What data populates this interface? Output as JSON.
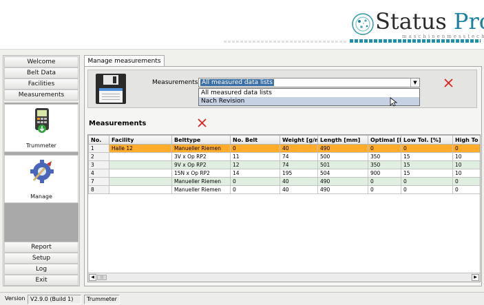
{
  "brand": {
    "name_part1": "Status",
    "name_part2": "Pro",
    "tagline": "maschinenmesstechnik",
    "accent_color": "#1a7fa0"
  },
  "sidebar": {
    "items_top": [
      "Welcome",
      "Belt Data",
      "Facilities",
      "Measurements"
    ],
    "tools": [
      {
        "label": "Trummeter",
        "icon": "trummeter-device-icon"
      },
      {
        "label": "Manage",
        "icon": "manage-gear-icon"
      }
    ],
    "items_bottom": [
      "Report",
      "Setup",
      "Log",
      "Exit"
    ]
  },
  "tab": {
    "label": "Manage measurements"
  },
  "measurementset": {
    "label": "Measurementset",
    "selected": "All measured data lists",
    "options": [
      "All measured data lists",
      "Nach Revision"
    ],
    "highlighted_option": 1
  },
  "measurements": {
    "title": "Measurements",
    "columns": [
      "No.",
      "Facility",
      "Belttype",
      "No. Belt",
      "Weight [g/m",
      "Length [mm]",
      "Optimal [N",
      "Low Tol. [%]",
      "High To"
    ],
    "rows": [
      [
        "1",
        "Halle 12",
        "Manueller Riemen",
        "0",
        "40",
        "490",
        "0",
        "0",
        "0"
      ],
      [
        "2",
        "",
        "3V x Op RP2",
        "11",
        "74",
        "500",
        "350",
        "15",
        "10"
      ],
      [
        "3",
        "",
        "9V x Op RP2",
        "12",
        "74",
        "501",
        "350",
        "15",
        "10"
      ],
      [
        "4",
        "",
        "15N x Op RP2",
        "14",
        "195",
        "504",
        "900",
        "15",
        "10"
      ],
      [
        "7",
        "",
        "Manueller Riemen",
        "0",
        "40",
        "490",
        "0",
        "0",
        "0"
      ],
      [
        "8",
        "",
        "Manueller Riemen",
        "0",
        "40",
        "490",
        "0",
        "0",
        "0"
      ]
    ],
    "selected_row": 0
  },
  "statusbar": {
    "version_label": "Version",
    "version_value": "V2.9.0  (Build 1)",
    "device": "Trummeter"
  },
  "colors": {
    "selected_row": "#ffab2c",
    "alt_row": "#dfeee0",
    "delete_icon": "#e02020"
  }
}
